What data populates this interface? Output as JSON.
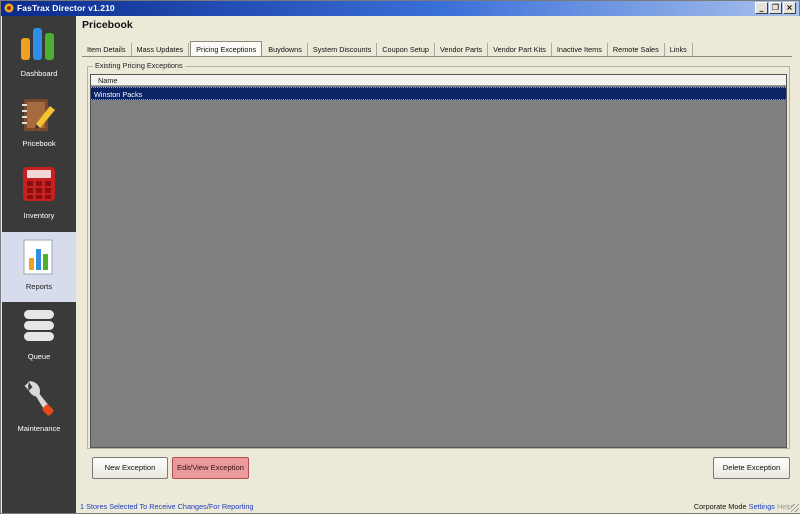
{
  "window": {
    "title": "FasTrax Director v1.210",
    "controls": {
      "minimize": "_",
      "restore": "❐",
      "close": "×"
    }
  },
  "sidebar": {
    "items": [
      {
        "label": "Dashboard",
        "icon": "bar-chart-icon",
        "active": false
      },
      {
        "label": "Pricebook",
        "icon": "notebook-pencil-icon",
        "active": false
      },
      {
        "label": "Inventory",
        "icon": "calculator-icon",
        "active": false
      },
      {
        "label": "Reports",
        "icon": "report-chart-icon",
        "active": true
      },
      {
        "label": "Queue",
        "icon": "stack-icon",
        "active": false
      },
      {
        "label": "Maintenance",
        "icon": "wrench-icon",
        "active": false
      }
    ]
  },
  "page": {
    "title": "Pricebook"
  },
  "tabs": [
    {
      "label": "Item Details",
      "active": false
    },
    {
      "label": "Mass Updates",
      "active": false
    },
    {
      "label": "Pricing Exceptions",
      "active": true
    },
    {
      "label": "Buydowns",
      "active": false
    },
    {
      "label": "System Discounts",
      "active": false
    },
    {
      "label": "Coupon Setup",
      "active": false
    },
    {
      "label": "Vendor Parts",
      "active": false
    },
    {
      "label": "Vendor Part Kits",
      "active": false
    },
    {
      "label": "Inactive Items",
      "active": false
    },
    {
      "label": "Remote Sales",
      "active": false
    },
    {
      "label": "Links",
      "active": false
    }
  ],
  "exceptions": {
    "group_label": "Existing Pricing Exceptions",
    "column_header": "Name",
    "rows": [
      {
        "name": "Winston Packs",
        "selected": true
      }
    ]
  },
  "buttons": {
    "new": "New Exception",
    "edit": "Edit/View Exception",
    "delete": "Delete Exception"
  },
  "status": {
    "left": "1 Stores Selected To Receive Changes/For Reporting",
    "mode": "Corporate Mode",
    "settings": "Settings",
    "help": "Help"
  },
  "colors": {
    "sidebar_bg": "#3a3a3a",
    "selection": "#0b2466",
    "grid_bg": "#7f7f7f",
    "edit_button": "#e99a9a",
    "title_gradient_start": "#0b2a8c"
  }
}
